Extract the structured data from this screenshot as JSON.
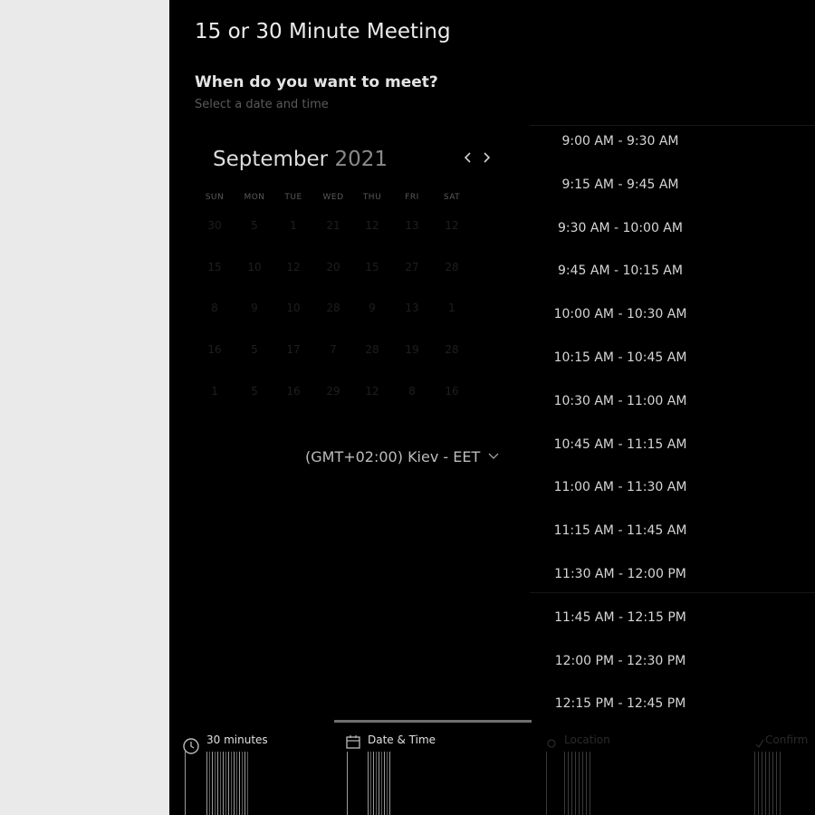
{
  "meeting": {
    "title": "15 or 30 Minute Meeting",
    "question": "When do you want to meet?",
    "subtitle": "Select a date and time"
  },
  "calendar": {
    "month": "September",
    "year": "2021",
    "weekdays": [
      "SUN",
      "MON",
      "TUE",
      "WED",
      "THU",
      "FRI",
      "SAT"
    ],
    "weeks": [
      [
        "30",
        "5",
        "1",
        "21",
        "12",
        "13",
        "12"
      ],
      [
        "15",
        "10",
        "12",
        "20",
        "15",
        "27",
        "28"
      ],
      [
        "8",
        "9",
        "10",
        "28",
        "9",
        "13",
        "1"
      ],
      [
        "16",
        "5",
        "17",
        "7",
        "28",
        "19",
        "28"
      ],
      [
        "1",
        "5",
        "16",
        "29",
        "12",
        "8",
        "16"
      ]
    ]
  },
  "timezone": "(GMT+02:00) Kiev - EET",
  "slots": [
    "9:00 AM - 9:30 AM",
    "9:15 AM - 9:45 AM",
    "9:30 AM - 10:00 AM",
    "9:45 AM - 10:15 AM",
    "10:00 AM - 10:30 AM",
    "10:15 AM - 10:45 AM",
    "10:30 AM - 11:00 AM",
    "10:45 AM - 11:15 AM",
    "11:00 AM - 11:30 AM",
    "11:15 AM - 11:45 AM",
    "11:30 AM - 12:00 PM",
    "11:45 AM - 12:15 PM",
    "12:00 PM - 12:30 PM",
    "12:15 PM - 12:45 PM"
  ],
  "steps": [
    {
      "label": "30 minutes",
      "icon": "clock-icon",
      "active": true
    },
    {
      "label": "Date & Time",
      "icon": "calendar-icon",
      "active": true
    },
    {
      "label": "Location",
      "icon": "location-icon",
      "active": false
    },
    {
      "label": "Confirm",
      "icon": "check-icon",
      "active": false
    }
  ],
  "colors": {
    "background": "#000000",
    "side": "#eaeaea",
    "progress": "#6f6f6f"
  }
}
